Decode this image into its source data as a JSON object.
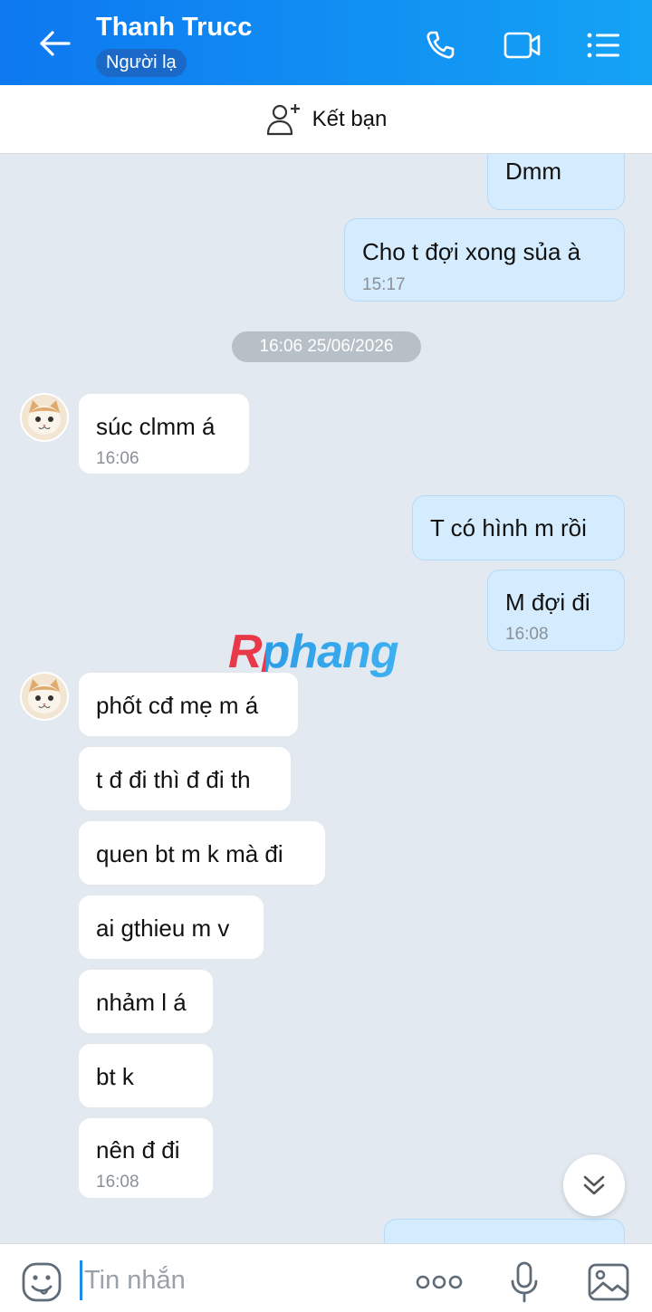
{
  "header": {
    "title": "Thanh Trucc",
    "badge": "Người lạ"
  },
  "add_friend": {
    "label": "Kết bạn"
  },
  "date_separator": "16:06 25/06/2026",
  "watermark": "Rphang",
  "messages": [
    {
      "side": "me",
      "text": "Dmm",
      "time": ""
    },
    {
      "side": "me",
      "text": "Cho t đợi xong sủa à",
      "time": "15:17"
    },
    {
      "side": "them",
      "text": "súc clmm á",
      "time": "16:06"
    },
    {
      "side": "me",
      "text": "T có hình m rồi",
      "time": ""
    },
    {
      "side": "me",
      "text": "M đợi đi",
      "time": "16:08"
    },
    {
      "side": "them",
      "text": "phốt cđ mẹ m á",
      "time": ""
    },
    {
      "side": "them",
      "text": "t đ đi thì đ đi th",
      "time": ""
    },
    {
      "side": "them",
      "text": "quen bt m k mà đi",
      "time": ""
    },
    {
      "side": "them",
      "text": "ai gthieu m v",
      "time": ""
    },
    {
      "side": "them",
      "text": "nhảm l á",
      "time": ""
    },
    {
      "side": "them",
      "text": "bt k",
      "time": ""
    },
    {
      "side": "them",
      "text": "nên đ đi",
      "time": "16:08"
    }
  ],
  "input": {
    "placeholder": "Tin nhắn"
  },
  "icons": {
    "back": "arrow-left-icon",
    "call": "phone-icon",
    "video": "video-icon",
    "menu": "list-icon",
    "add_friend": "user-plus-icon",
    "emoji": "emoji-icon",
    "more": "more-icon",
    "mic": "microphone-icon",
    "image": "image-icon",
    "scroll": "chevron-double-down-icon"
  },
  "colors": {
    "header_start": "#0d78f0",
    "header_end": "#14a3f5",
    "my_bubble": "#d4ecfe",
    "their_bubble": "#ffffff",
    "chat_bg": "#e2e9f0"
  }
}
